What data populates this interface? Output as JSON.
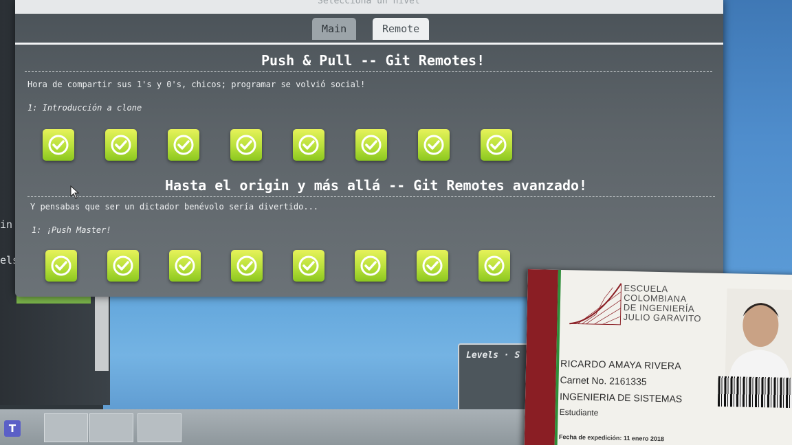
{
  "left_window": {
    "text_1": "in",
    "text_2": "els'"
  },
  "app": {
    "topbar_text": "Selecciona un nivel",
    "tabs": [
      {
        "label": "Main"
      },
      {
        "label": "Remote"
      }
    ],
    "sections": [
      {
        "title": "Push & Pull -- Git Remotes!",
        "description": "Hora de compartir sus 1's y 0's, chicos; programar se volvió social!",
        "level_label": "1: Introducción a clone",
        "levels_completed": 8
      },
      {
        "title": "Hasta el origin y más allá -- Git Remotes avanzado!",
        "description": "Y pensabas que ser un dictador benévolo sería divertido...",
        "level_label": "1: ¡Push Master!",
        "levels_completed": 8
      }
    ]
  },
  "levels_overlay": {
    "title": "Levels · S"
  },
  "id_card": {
    "school_line_1": "ESCUELA",
    "school_line_2": "COLOMBIANA",
    "school_line_3": "DE INGENIERÍA",
    "school_line_4": "JULIO GARAVITO",
    "name": "RICARDO AMAYA RIVERA",
    "carnet": "Carnet No. 2161335",
    "program": "INGENIERIA DE SISTEMAS",
    "role": "Estudiante",
    "issue_date": "Fecha de expedición: 11 enero 2018"
  },
  "colors": {
    "badge_top": "#e6f25a",
    "badge_bottom": "#8cc71f",
    "card_stripe": "#8a1e24"
  }
}
